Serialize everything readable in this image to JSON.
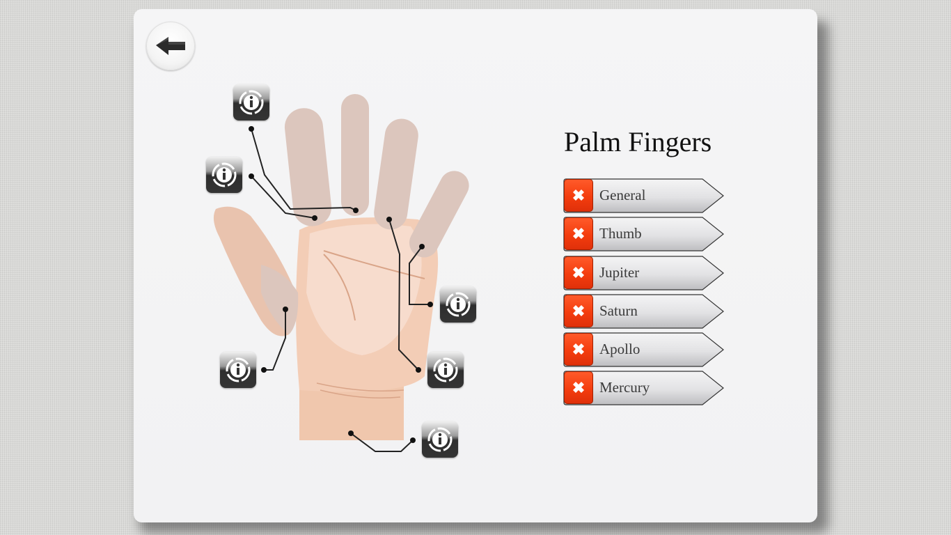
{
  "page": {
    "title": "Palm Fingers",
    "back_button_label": "Back"
  },
  "menu": {
    "items": [
      {
        "label": "General",
        "status": "incomplete"
      },
      {
        "label": "Thumb",
        "status": "incomplete"
      },
      {
        "label": "Jupiter",
        "status": "incomplete"
      },
      {
        "label": "Saturn",
        "status": "incomplete"
      },
      {
        "label": "Apollo",
        "status": "incomplete"
      },
      {
        "label": "Mercury",
        "status": "incomplete"
      }
    ]
  },
  "hand_diagram": {
    "info_markers": [
      {
        "target": "saturn-finger-base",
        "icon": "info-icon"
      },
      {
        "target": "jupiter-finger-base",
        "icon": "info-icon"
      },
      {
        "target": "mercury-finger-base",
        "icon": "info-icon"
      },
      {
        "target": "thumb-base",
        "icon": "info-icon"
      },
      {
        "target": "apollo-finger-base",
        "icon": "info-icon"
      },
      {
        "target": "wrist",
        "icon": "info-icon"
      }
    ]
  },
  "colors": {
    "accent_red": "#f43d0e",
    "skin": "#f3cdb6",
    "finger_tint": "#dcc6bd"
  }
}
